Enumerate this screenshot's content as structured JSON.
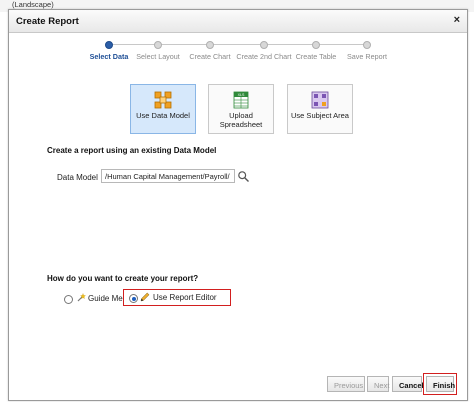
{
  "background": {
    "text": "(Landscape)"
  },
  "dialog": {
    "title": "Create Report",
    "close_label": "×"
  },
  "train": {
    "steps": [
      {
        "label": "Select Data",
        "active": true
      },
      {
        "label": "Select Layout",
        "active": false
      },
      {
        "label": "Create Chart",
        "active": false
      },
      {
        "label": "Create 2nd Chart",
        "active": false
      },
      {
        "label": "Create Table",
        "active": false
      },
      {
        "label": "Save Report",
        "active": false
      }
    ]
  },
  "sources": [
    {
      "label": "Use Data Model",
      "icon": "data-model-icon",
      "selected": true
    },
    {
      "label": "Upload Spreadsheet",
      "icon": "spreadsheet-icon",
      "icon_text": "XLS",
      "selected": false
    },
    {
      "label": "Use Subject Area",
      "icon": "subject-area-icon",
      "selected": false
    }
  ],
  "data_model_section": {
    "title": "Create a report using an existing Data Model",
    "label": "Data Model",
    "value": "/Human Capital Management/Payroll/",
    "search_icon": "magnifier-icon"
  },
  "create_section": {
    "title": "How do you want to create your report?",
    "guide_me": {
      "label": "Guide Me",
      "checked": false,
      "icon": "wand-icon"
    },
    "report_editor": {
      "label": "Use Report Editor",
      "checked": true,
      "icon": "pencil-icon"
    }
  },
  "buttons": {
    "previous": "Previous",
    "next": "Next",
    "cancel": "Cancel",
    "finish": "Finish"
  },
  "colors": {
    "accent": "#2b5ea8",
    "highlight": "#d21f1f",
    "selected_tile": "#d6e8fb"
  }
}
